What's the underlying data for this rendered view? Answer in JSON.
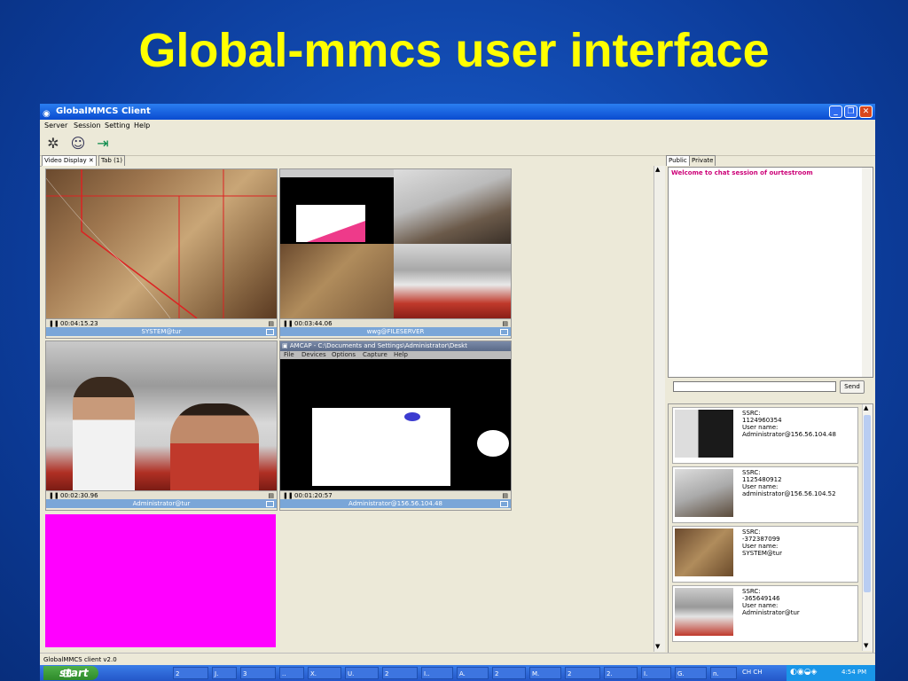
{
  "slide": {
    "title": "Global-mmcs user interface"
  },
  "window": {
    "title": "GlobalMMCS Client",
    "menu": [
      "Server",
      "Session",
      "Setting",
      "Help"
    ],
    "toolbar_icons": [
      "network-icon",
      "users-icon",
      "exit-icon"
    ],
    "tabs": [
      {
        "label": "Video Display",
        "close": "✕"
      },
      {
        "label": "Tab (1)"
      }
    ],
    "videos": [
      {
        "time": "00:04:15.23",
        "name": "SYSTEM@tur"
      },
      {
        "time": "00:03:44.06",
        "name": "wwg@FILESERVER"
      },
      {
        "time": "00:02:30.96",
        "name": "Administrator@tur"
      },
      {
        "time": "00:01:20:57",
        "name": "Administrator@156.56.104.48"
      }
    ],
    "amcap": {
      "title": "AMCAP - C:\\Documents and Settings\\Administrator\\Deskt",
      "menu": [
        "File",
        "Devices",
        "Options",
        "Capture",
        "Help"
      ]
    },
    "chat": {
      "tabs": [
        "Public",
        "Private"
      ],
      "welcome": "Welcome to chat session of ourtestroom",
      "send_label": "Send",
      "input_value": ""
    },
    "sources": [
      {
        "ssrc_label": "SSRC:",
        "ssrc": "1124960354",
        "user_label": "User name:",
        "user": "Administrator@156.56.104.48"
      },
      {
        "ssrc_label": "SSRC:",
        "ssrc": "1125480912",
        "user_label": "User name:",
        "user": "administrator@156.56.104.52"
      },
      {
        "ssrc_label": "SSRC:",
        "ssrc": "-372387099",
        "user_label": "User name:",
        "user": "SYSTEM@tur"
      },
      {
        "ssrc_label": "SSRC:",
        "ssrc": "-365649146",
        "user_label": "User name:",
        "user": "Administrator@tur"
      }
    ],
    "status": "GlobalMMCS client v2.0"
  },
  "taskbar": {
    "start": "start",
    "buttons": [
      "2",
      "J.",
      "3",
      "..",
      "X.",
      "U.",
      "2",
      "I..",
      "A.",
      "2",
      "M.",
      "2",
      "2.",
      "I.",
      "G.",
      "n."
    ],
    "lang": "CH  CH",
    "clock": "4:54 PM"
  },
  "colors": {
    "slide_bg": "#0c3c9a",
    "title": "#ffff00",
    "pink_pane": "#ff00ff",
    "chat_welcome": "#cc0077"
  }
}
